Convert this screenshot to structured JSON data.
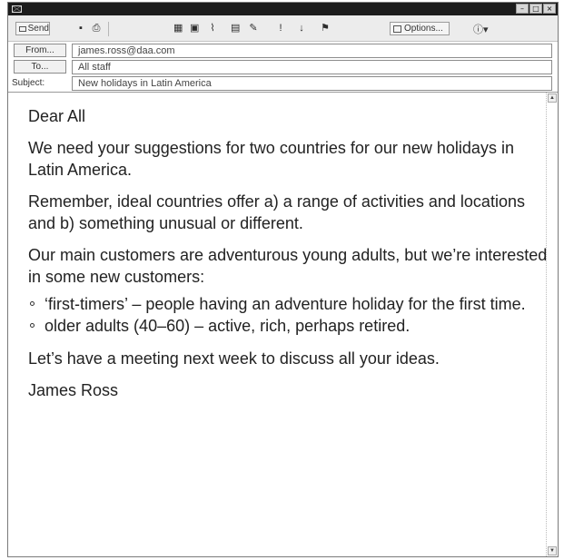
{
  "toolbar": {
    "send_label": "Send",
    "options_label": "Options...",
    "icons": [
      "save-icon",
      "print-icon",
      "address-book-icon",
      "check-names-icon",
      "attach-icon",
      "insert-file-icon",
      "signature-icon",
      "high-importance-icon",
      "low-importance-icon",
      "flag-icon",
      "help-icon"
    ]
  },
  "header": {
    "from_label": "From...",
    "from_value": "james.ross@daa.com",
    "to_label": "To...",
    "to_value": "All staff",
    "subject_label": "Subject:",
    "subject_value": "New holidays in Latin America"
  },
  "message": {
    "greeting": "Dear All",
    "paragraphs": [
      "We need your suggestions for two countries for our new holidays in Latin America.",
      "Remember, ideal countries offer a) a range of activities and locations and b) something unusual or different.",
      "Our main customers are adventurous young adults, but we’re interested in some new customers:"
    ],
    "bullets": [
      "‘first-timers’ – people having an adventure holiday for the first time.",
      "older adults (40–60) – active, rich, perhaps retired."
    ],
    "closing": "Let’s have a meeting next week to discuss all your ideas.",
    "signature": "James Ross"
  }
}
